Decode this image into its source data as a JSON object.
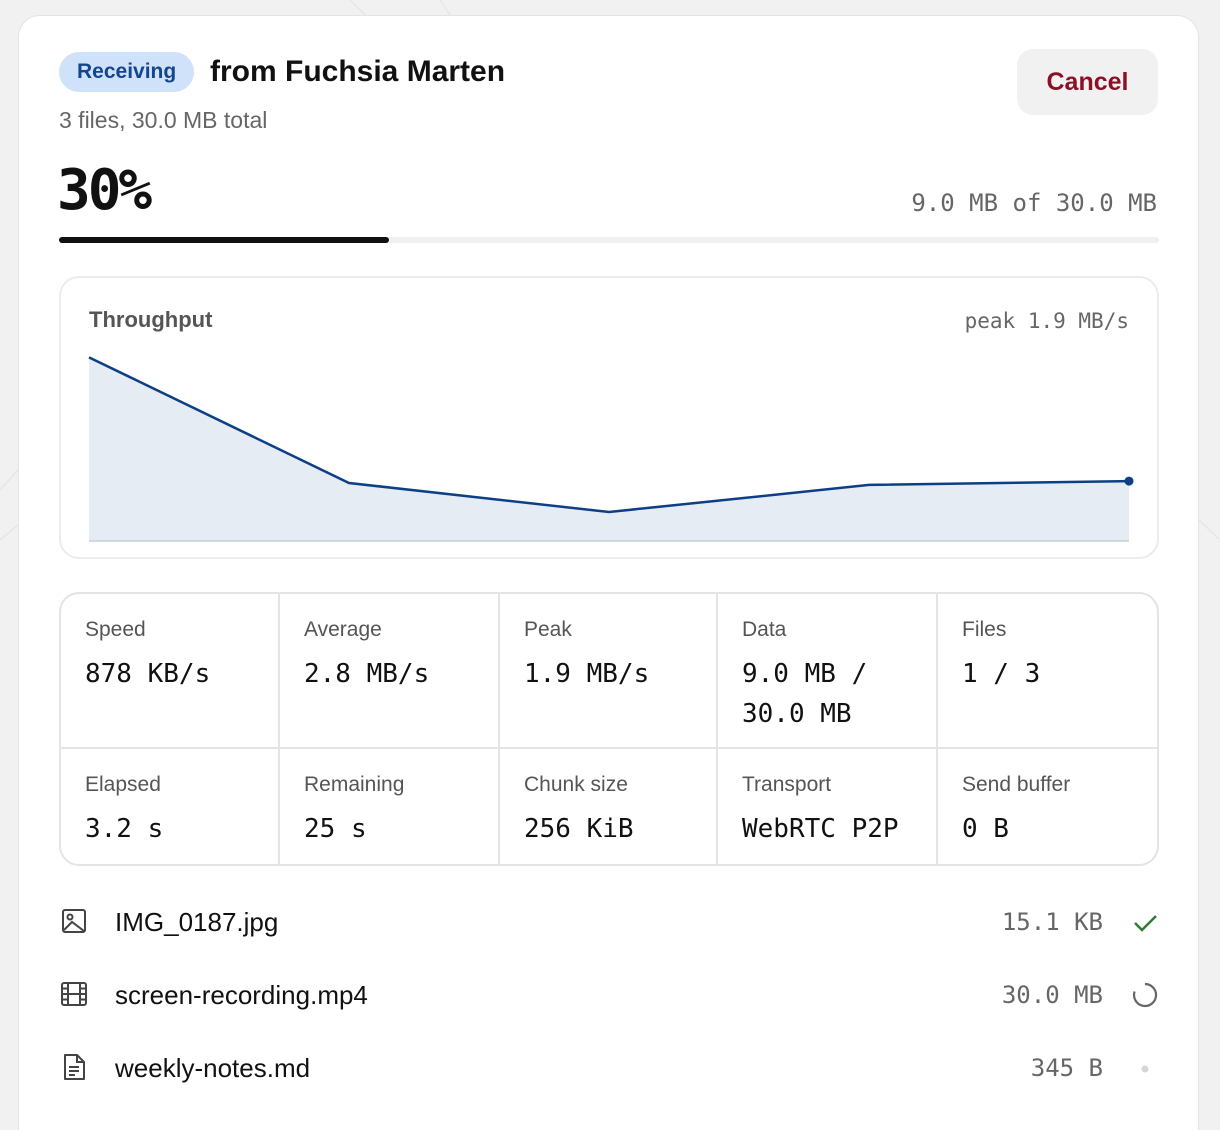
{
  "transfer": {
    "status_badge": "Receiving",
    "title": "from Fuchsia Marten",
    "summary": "3 files, 30.0 MB total",
    "cancel_label": "Cancel",
    "percent_label": "30%",
    "progress_fraction": 0.3,
    "bytes_label": "9.0 MB of 30.0 MB"
  },
  "chart": {
    "title": "Throughput",
    "peak_label": "peak 1.9 MB/s",
    "line_color": "#0d3f86",
    "fill_color": "#e6ecf4"
  },
  "chart_data": {
    "type": "area",
    "title": "Throughput",
    "series": [
      {
        "values": [
          1.9,
          0.6,
          0.3,
          0.58,
          0.62
        ]
      }
    ],
    "x": [
      1,
      2,
      3,
      4,
      5
    ],
    "ylim": [
      0,
      2.1
    ],
    "grid": false
  },
  "stats": [
    {
      "label": "Speed",
      "value": "878 KB/s"
    },
    {
      "label": "Average",
      "value": "2.8 MB/s"
    },
    {
      "label": "Peak",
      "value": "1.9 MB/s"
    },
    {
      "label": "Data",
      "value": "9.0 MB / 30.0 MB"
    },
    {
      "label": "Files",
      "value": "1 / 3"
    },
    {
      "label": "Elapsed",
      "value": "3.2 s"
    },
    {
      "label": "Remaining",
      "value": "25 s"
    },
    {
      "label": "Chunk size",
      "value": "256 KiB"
    },
    {
      "label": "Transport",
      "value": "WebRTC P2P"
    },
    {
      "label": "Send buffer",
      "value": "0 B"
    }
  ],
  "files": [
    {
      "name": "IMG_0187.jpg",
      "size": "15.1 KB",
      "icon": "image-icon",
      "status": "complete"
    },
    {
      "name": "screen-recording.mp4",
      "size": "30.0 MB",
      "icon": "film-icon",
      "status": "in-progress"
    },
    {
      "name": "weekly-notes.md",
      "size": "345 B",
      "icon": "document-icon",
      "status": "queued"
    }
  ],
  "colors": {
    "badge_bg": "#cfe2f9",
    "badge_text": "#14468f",
    "cancel_text": "#8c1026",
    "complete_check": "#2f7d32"
  }
}
